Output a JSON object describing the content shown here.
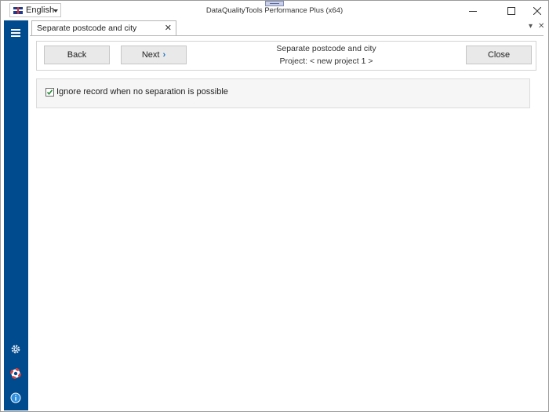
{
  "titlebar": {
    "language": "English",
    "title": "DataQualityTools Performance Plus (x64)",
    "controls": [
      "minimize",
      "maximize",
      "close"
    ]
  },
  "sidebar": {
    "menu_icon": "hamburger-icon",
    "bottom_icons": [
      "gear-icon",
      "lifebuoy-icon",
      "info-icon"
    ]
  },
  "tab": {
    "label": "Separate postcode and city"
  },
  "toolbar": {
    "back_label": "Back",
    "next_label": "Next",
    "close_label": "Close",
    "heading_title": "Separate postcode and city",
    "heading_project": "Project: < new project 1 >"
  },
  "options": {
    "ignore_label": "Ignore record when no separation is possible",
    "ignore_checked": true
  },
  "colors": {
    "sidebar": "#004b8d",
    "accent": "#1976c8"
  }
}
